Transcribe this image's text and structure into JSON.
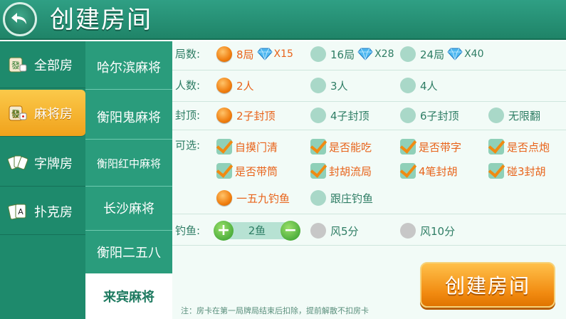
{
  "header": {
    "title": "创建房间"
  },
  "categories": [
    {
      "label": "全部房",
      "icon": "fa-tile-icon",
      "active": false
    },
    {
      "label": "麻将房",
      "icon": "fa-tile-dice-icon",
      "active": true
    },
    {
      "label": "字牌房",
      "icon": "card-fan-icon",
      "active": false
    },
    {
      "label": "扑克房",
      "icon": "poker-cards-icon",
      "active": false
    }
  ],
  "games": [
    {
      "label": "哈尔滨麻将"
    },
    {
      "label": "衡阳鬼麻将"
    },
    {
      "label": "衡阳红中麻将"
    },
    {
      "label": "长沙麻将"
    },
    {
      "label": "衡阳二五八"
    },
    {
      "label": "来宾麻将"
    }
  ],
  "rounds": {
    "label": "局数:",
    "options": [
      {
        "text": "8局",
        "mult": "X15",
        "selected": true
      },
      {
        "text": "16局",
        "mult": "X28",
        "selected": false
      },
      {
        "text": "24局",
        "mult": "X40",
        "selected": false
      }
    ]
  },
  "players": {
    "label": "人数:",
    "options": [
      {
        "text": "2人",
        "selected": true
      },
      {
        "text": "3人",
        "selected": false
      },
      {
        "text": "4人",
        "selected": false
      }
    ]
  },
  "cap": {
    "label": "封顶:",
    "options": [
      {
        "text": "2子封顶",
        "selected": true
      },
      {
        "text": "4子封顶",
        "selected": false
      },
      {
        "text": "6子封顶",
        "selected": false
      },
      {
        "text": "无限翻",
        "selected": false
      }
    ]
  },
  "optional": {
    "label": "可选:",
    "checks": [
      "自摸门清",
      "是否能吃",
      "是否带字",
      "是否点炮",
      "是否带筒",
      "封胡流局",
      "4笔封胡",
      "碰3封胡"
    ],
    "fishing_modes": [
      {
        "text": "一五九钓鱼",
        "selected": true
      },
      {
        "text": "跟庄钓鱼",
        "selected": false
      }
    ]
  },
  "fishing": {
    "label": "钓鱼:",
    "value": "2鱼",
    "options": [
      {
        "text": "风5分",
        "selected": false
      },
      {
        "text": "风10分",
        "selected": false
      }
    ]
  },
  "create_button": "创建房间",
  "note": "注：房卡在第一局牌局结束后扣除，提前解散不扣房卡",
  "colors": {
    "header": "#1f8468",
    "accent": "#f18a10",
    "selected_text": "#e8631a"
  }
}
